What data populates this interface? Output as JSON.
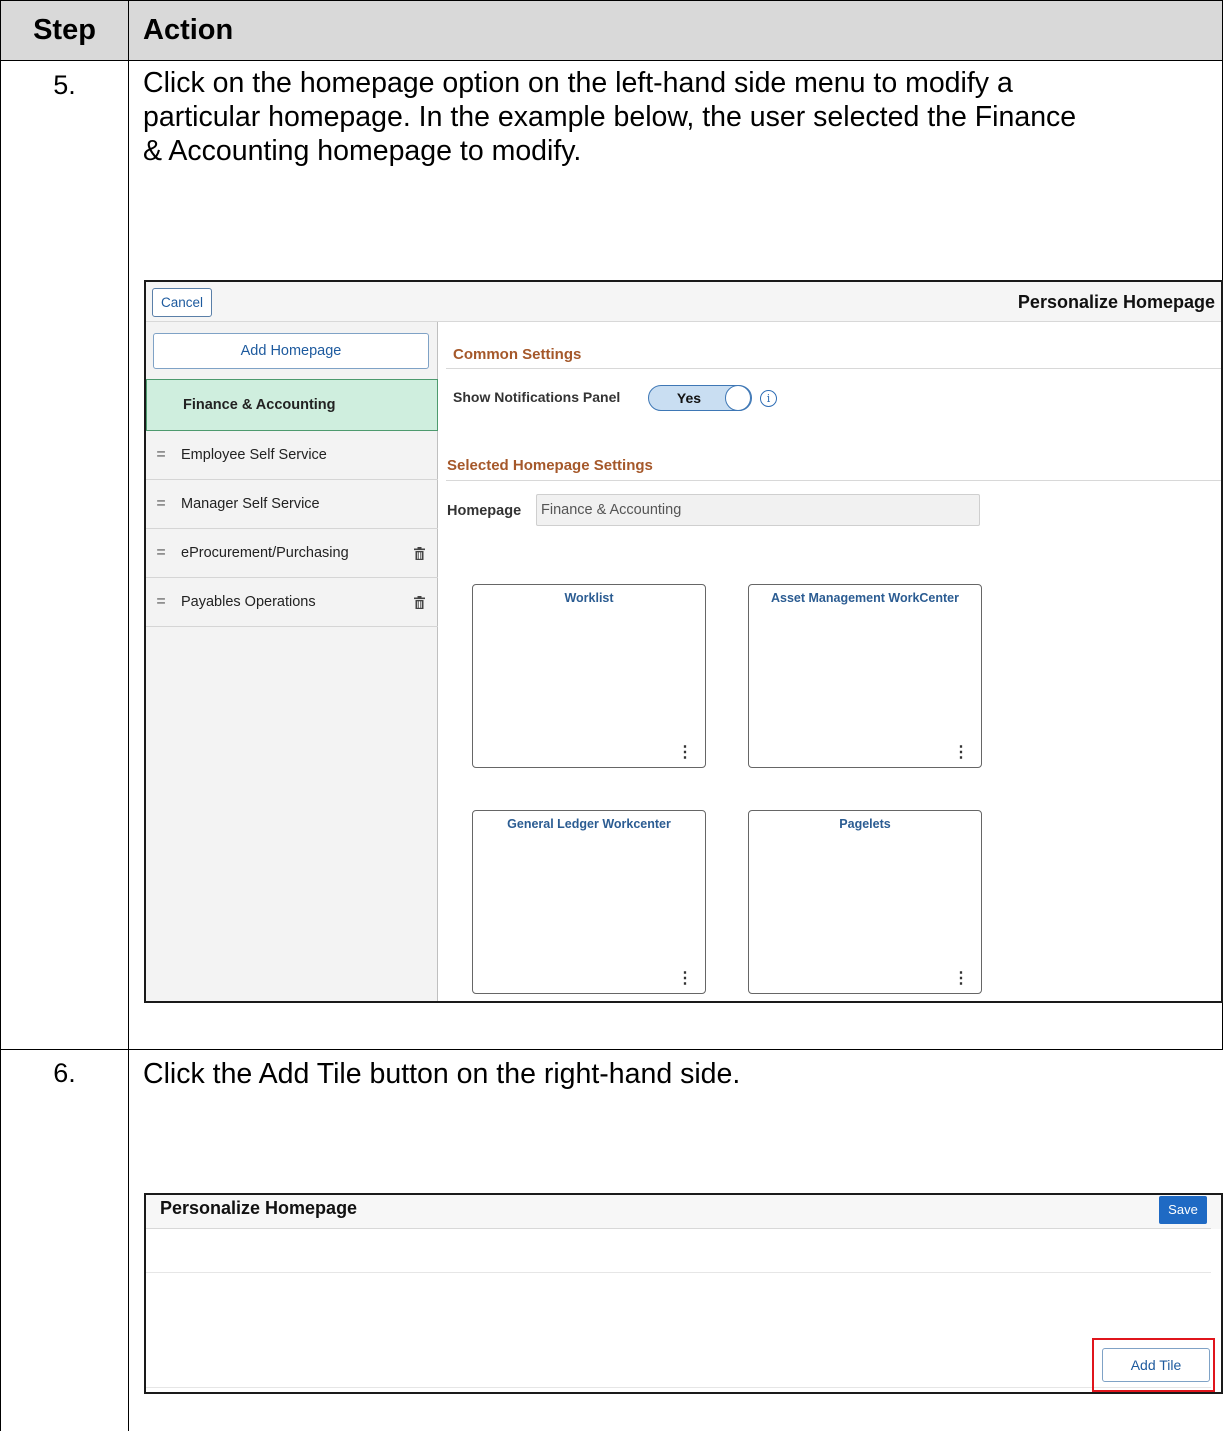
{
  "table": {
    "header_step": "Step",
    "header_action": "Action"
  },
  "rows": [
    {
      "step": "5.",
      "text_lines": [
        "Click on the homepage option on the left-hand side menu to modify a",
        "particular homepage. In the example below, the user selected the Finance",
        "& Accounting homepage to modify."
      ]
    },
    {
      "step": "6.",
      "text_lines": [
        "Click the Add Tile button on the right-hand side."
      ]
    }
  ],
  "shot1": {
    "cancel_label": "Cancel",
    "title": "Personalize Homepage",
    "add_homepage_label": "Add Homepage",
    "homepages": [
      {
        "label": "Finance & Accounting",
        "selected": true
      },
      {
        "label": "Employee Self Service",
        "grip": "="
      },
      {
        "label": "Manager Self Service",
        "grip": "="
      },
      {
        "label": "eProcurement/Purchasing",
        "grip": "=",
        "trash": "🗑"
      },
      {
        "label": "Payables Operations",
        "grip": "=",
        "trash": "🗑"
      }
    ],
    "common_settings_title": "Common Settings",
    "show_notifications_label": "Show Notifications Panel",
    "toggle_value": "Yes",
    "info_glyph": "i",
    "selected_settings_title": "Selected Homepage Settings",
    "homepage_label": "Homepage",
    "homepage_value": "Finance & Accounting",
    "tiles": [
      {
        "title": "Worklist"
      },
      {
        "title": "Asset Management WorkCenter"
      },
      {
        "title": "General Ledger Workcenter"
      },
      {
        "title": "Pagelets"
      }
    ],
    "more_glyph": "⋮"
  },
  "shot2": {
    "title": "Personalize Homepage",
    "save_label": "Save",
    "add_tile_label": "Add Tile"
  },
  "colors": {
    "accent_blue": "#1f6ac4",
    "section_title": "#a5582a",
    "selected_bg": "#cfeede",
    "highlight_red": "#e0151c",
    "header_gray": "#d9d9d9"
  }
}
